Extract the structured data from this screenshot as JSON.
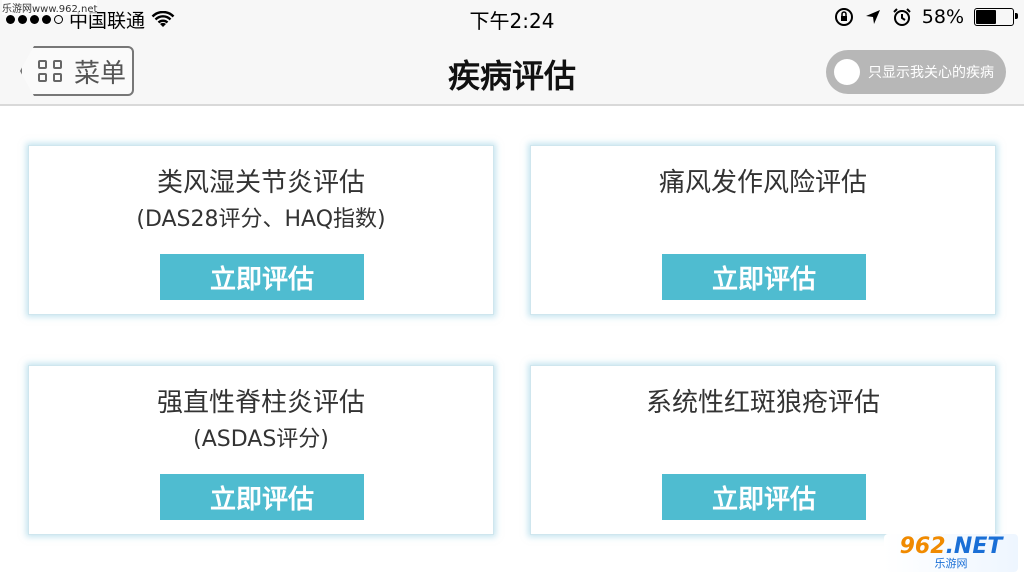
{
  "watermark": {
    "top_text": "乐游网www.962.net",
    "logo_main": "962",
    "logo_suffix": ".NET",
    "logo_sub": "乐游网"
  },
  "status_bar": {
    "carrier": "中国联通",
    "time": "下午2:24",
    "battery_percent": "58%",
    "battery_level": 0.58
  },
  "nav": {
    "menu_label": "菜单",
    "title": "疾病评估",
    "toggle_label": "只显示我关心的疾病",
    "toggle_on": false
  },
  "cards": [
    {
      "title": "类风湿关节炎评估",
      "subtitle": "(DAS28评分、HAQ指数)",
      "button": "立即评估"
    },
    {
      "title": "痛风发作风险评估",
      "subtitle": "",
      "button": "立即评估"
    },
    {
      "title": "强直性脊柱炎评估",
      "subtitle": "(ASDAS评分)",
      "button": "立即评估"
    },
    {
      "title": "系统性红斑狼疮评估",
      "subtitle": "",
      "button": "立即评估"
    }
  ],
  "colors": {
    "accent": "#4fbcd0",
    "toggle_bg": "#b7b7b7",
    "card_glow": "#96cde1"
  }
}
